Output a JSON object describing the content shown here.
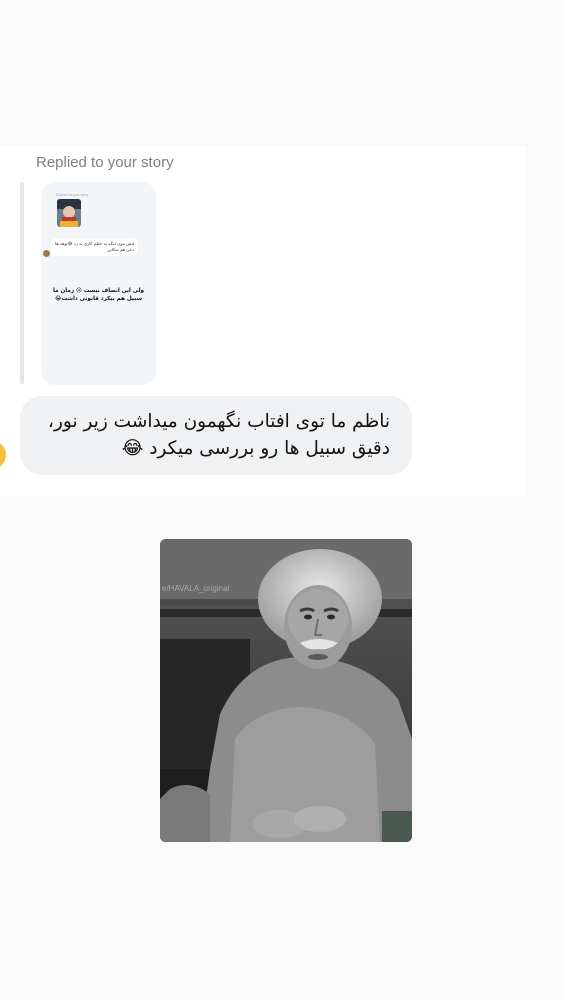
{
  "reply_header": "Replied to your story",
  "story_preview": {
    "header": "Replied to your story",
    "mini_message": "لیش مون دیگه به ناظم گازی نه زد 😂نوهه ها دعن هم سکاین",
    "overlay_text": "ولی این انصاف نیست 😢 زمان ما سبیل هم بیکرد قانونی داشت😂"
  },
  "message": {
    "line1": "ناظم ما توی افتاب نگهمون میداشت زیر نور،",
    "line2": "دقیق سبیل ها رو بررسی میکرد 😂"
  },
  "photo": {
    "watermark": "e/HAVALA_original",
    "icon": "image-attachment"
  }
}
